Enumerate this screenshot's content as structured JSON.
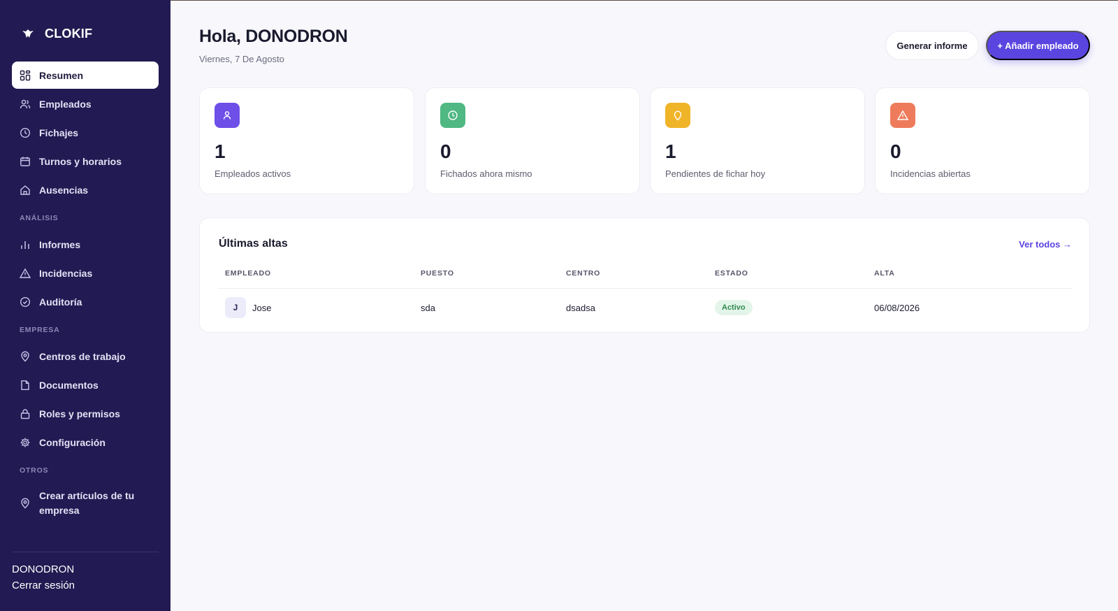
{
  "brand": {
    "name": "CLOKIF",
    "icon": "bird-logo-icon"
  },
  "sidebar": {
    "main_items": [
      {
        "label": "Resumen",
        "icon": "dashboard-icon",
        "active": true
      },
      {
        "label": "Empleados",
        "icon": "users-icon"
      },
      {
        "label": "Fichajes",
        "icon": "clock-icon"
      },
      {
        "label": "Turnos y horarios",
        "icon": "calendar-icon"
      },
      {
        "label": "Ausencias",
        "icon": "home-icon"
      }
    ],
    "section_analisis": "ANÁLISIS",
    "analisis_items": [
      {
        "label": "Informes",
        "icon": "bar-chart-icon"
      },
      {
        "label": "Incidencias",
        "icon": "warning-icon"
      },
      {
        "label": "Auditoría",
        "icon": "check-circle-icon"
      }
    ],
    "section_empresa": "EMPRESA",
    "empresa_items": [
      {
        "label": "Centros de trabajo",
        "icon": "map-pin-icon"
      },
      {
        "label": "Documentos",
        "icon": "document-icon"
      },
      {
        "label": "Roles y permisos",
        "icon": "lock-icon"
      },
      {
        "label": "Configuración",
        "icon": "gear-icon"
      }
    ],
    "section_otros": "OTROS",
    "otros_items": [
      {
        "label": "Crear artículos de tu empresa",
        "icon": "map-pin-icon"
      }
    ],
    "user_name": "DONODRON",
    "logout_label": "Cerrar sesión"
  },
  "header": {
    "greeting": "Hola, DONODRON",
    "date": "Viernes, 7 De Agosto",
    "report_button": "Generar informe",
    "add_button": "+ Añadir empleado"
  },
  "stats": [
    {
      "value": "1",
      "label": "Empleados activos",
      "icon": "user-icon",
      "color": "#6e4fe8"
    },
    {
      "value": "0",
      "label": "Fichados ahora mismo",
      "icon": "clock-icon",
      "color": "#4fb883"
    },
    {
      "value": "1",
      "label": "Pendientes de fichar hoy",
      "icon": "map-pin-icon",
      "color": "#f0b429"
    },
    {
      "value": "0",
      "label": "Incidencias abiertas",
      "icon": "warning-icon",
      "color": "#ee7b5b"
    }
  ],
  "recent": {
    "title": "Últimas altas",
    "view_all": "Ver todos →",
    "columns": [
      "EMPLEADO",
      "PUESTO",
      "CENTRO",
      "ESTADO",
      "ALTA"
    ],
    "rows": [
      {
        "initial": "J",
        "name": "Jose",
        "position": "sda",
        "center": "dsadsa",
        "status": "Activo",
        "date": "06/08/2026"
      }
    ]
  }
}
